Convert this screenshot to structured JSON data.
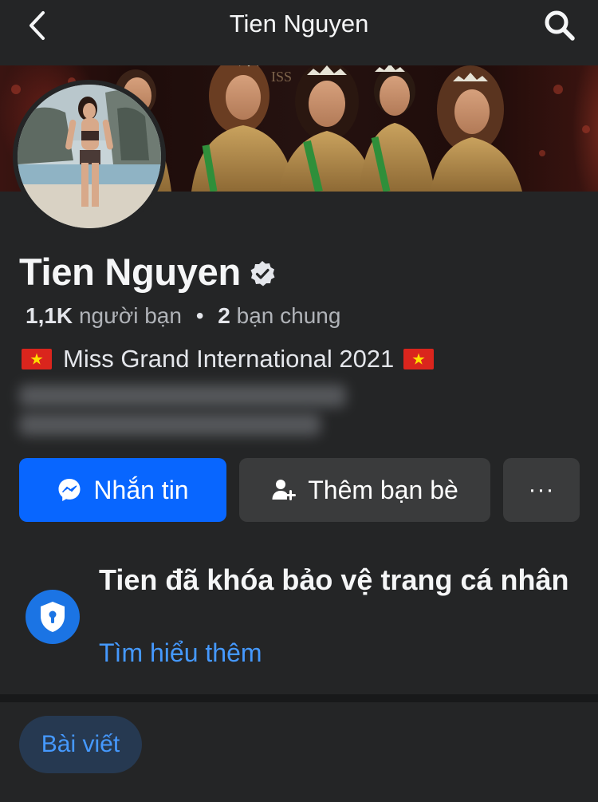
{
  "nav": {
    "title": "Tien Nguyen",
    "back_icon": "chevron-left-icon",
    "search_icon": "search-icon"
  },
  "profile": {
    "name": "Tien Nguyen",
    "verified_icon": "verified-badge-icon",
    "friend_count": "1,1K",
    "friend_label": "người bạn",
    "separator": "•",
    "mutual_count": "2",
    "mutual_label": "bạn chung",
    "bio": "Miss Grand International 2021",
    "bio_flag_icon": "vietnam-flag-icon"
  },
  "actions": {
    "message_label": "Nhắn tin",
    "message_icon": "messenger-icon",
    "add_friend_label": "Thêm bạn bè",
    "add_friend_icon": "add-friend-icon",
    "more_label": "···"
  },
  "lock_notice": {
    "icon": "shield-lock-icon",
    "title": "Tien đã khóa bảo vệ trang cá nhân",
    "link": "Tìm hiểu thêm"
  },
  "tabs": {
    "posts_label": "Bài viết"
  },
  "colors": {
    "background": "#242526",
    "primary_button": "#0866ff",
    "secondary_button": "#3a3b3c",
    "link": "#4599ff",
    "tab_active_bg": "#263951",
    "lock_badge": "#1b74e4"
  }
}
